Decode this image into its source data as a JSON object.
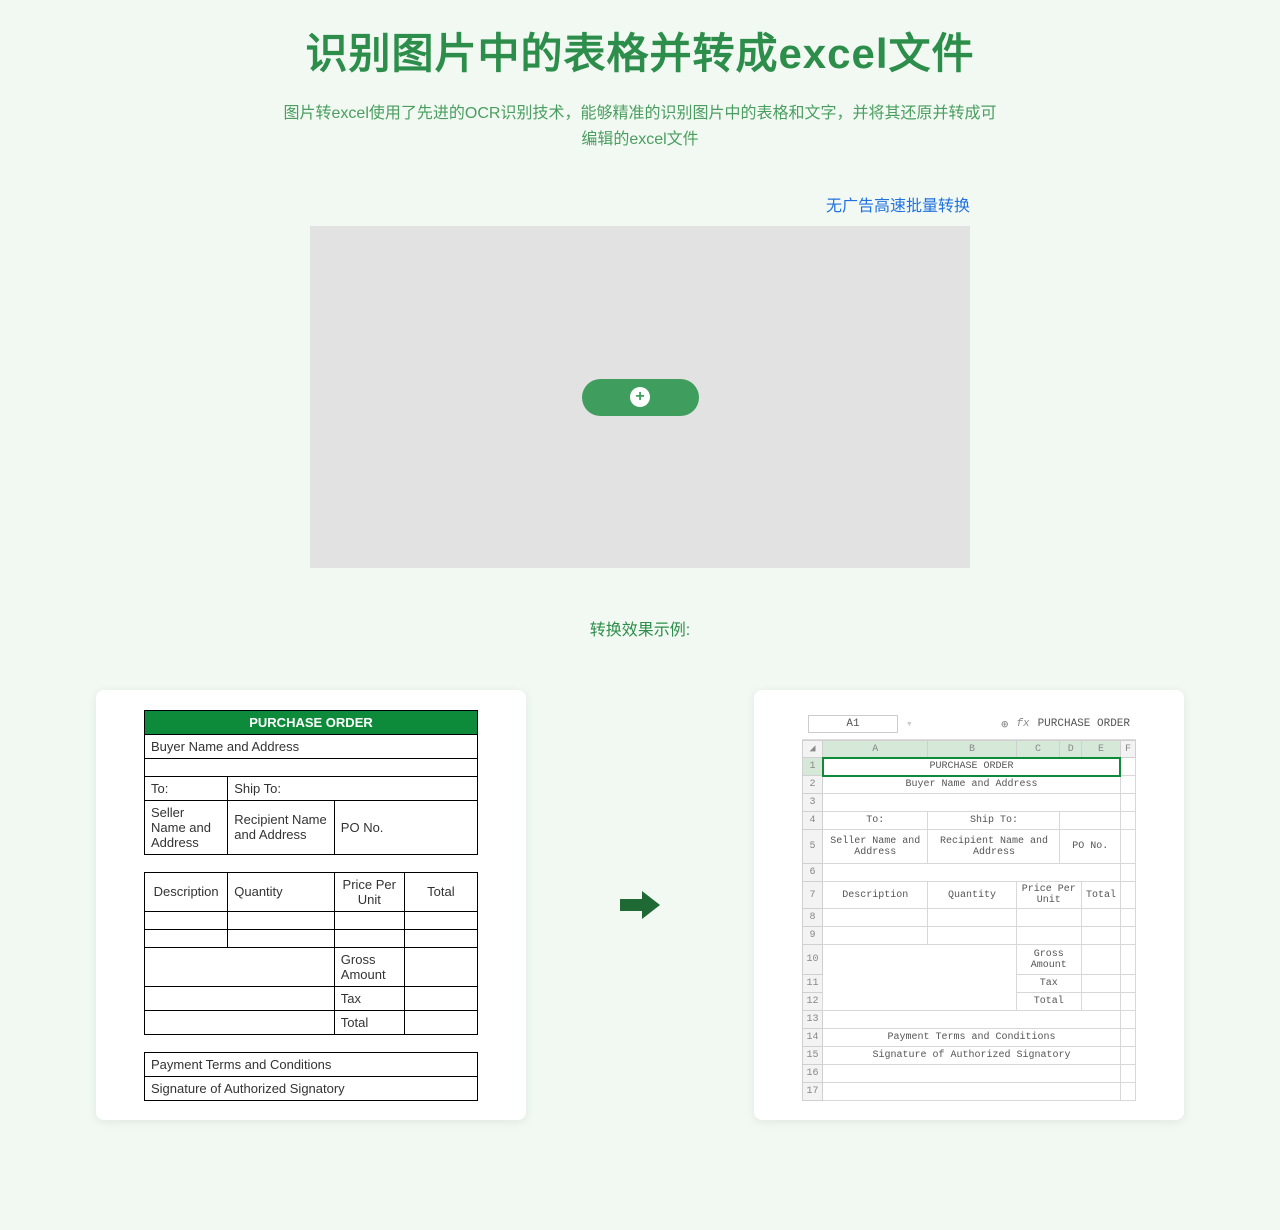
{
  "header": {
    "title": "识别图片中的表格并转成excel文件",
    "subtitle": "图片转excel使用了先进的OCR识别技术，能够精准的识别图片中的表格和文字，并将其还原并转成可编辑的excel文件"
  },
  "promo_link": "无广告高速批量转换",
  "add_button": "+",
  "example_label": "转换效果示例:",
  "po": {
    "header": "PURCHASE ORDER",
    "buyer": "Buyer Name and Address",
    "to": "To:",
    "ship_to": "Ship To:",
    "seller": "Seller Name and Address",
    "recipient": "Recipient Name and Address",
    "po_no": "PO No.",
    "cols": {
      "desc": "Description",
      "qty": "Quantity",
      "price": "Price Per Unit",
      "total": "Total"
    },
    "gross": "Gross Amount",
    "tax": "Tax",
    "total_row": "Total",
    "terms": "Payment Terms and Conditions",
    "signature": "Signature of Authorized Signatory"
  },
  "excel": {
    "cell_ref": "A1",
    "fx": "fx",
    "formula_value": "PURCHASE ORDER",
    "cols": [
      "A",
      "B",
      "C",
      "D",
      "E",
      "F"
    ],
    "r1": "PURCHASE ORDER",
    "r2": "Buyer Name and Address",
    "r4_to": "To:",
    "r4_ship": "Ship To:",
    "r5_seller": "Seller Name and Address",
    "r5_recipient": "Recipient Name and Address",
    "r5_pono": "PO No.",
    "r7_desc": "Description",
    "r7_qty": "Quantity",
    "r7_price": "Price Per Unit",
    "r7_total": "Total",
    "r10_gross": "Gross Amount",
    "r11_tax": "Tax",
    "r12_total": "Total",
    "r14_terms": "Payment Terms and Conditions",
    "r15_sig": "Signature of Authorized Signatory"
  }
}
